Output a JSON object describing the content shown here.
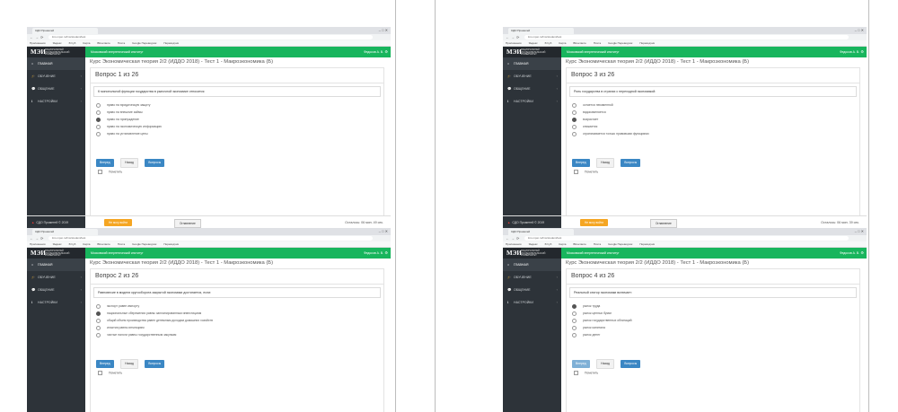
{
  "browser": {
    "tab_title": "СДО Прометей",
    "address": "lms.mpei.ru/lms/student/test",
    "bookmarks": [
      "Приложения",
      "Яндекс",
      "Ютуб",
      "Карта",
      "ВКонтакте",
      "Почта",
      "Google Переводчик",
      "Переводчик"
    ]
  },
  "sidebar": {
    "logo_mark": "МЭИ",
    "logo_text": "НАЦИОНАЛЬНЫЙ ИССЛЕДОВАТЕЛЬСКИЙ УНИВЕРСИТЕТ",
    "items": [
      {
        "label": "ГЛАВНАЯ",
        "icon": "home-icon"
      },
      {
        "label": "ОБУЧЕНИЕ",
        "icon": "graduation-cap-icon"
      },
      {
        "label": "ОБЩЕНИЕ",
        "icon": "chat-icon"
      },
      {
        "label": "НАСТРОЙКИ",
        "icon": "info-icon"
      }
    ],
    "footer": "СДО Прометей © 2019"
  },
  "header": {
    "institute": "Московский энергетический институт",
    "user": "Федосов А. В."
  },
  "course_title": "Курс Экономическая теория 2/2 (ИДДО 2018) - Тест 1 - Макроэкономика (Б)",
  "buttons": {
    "forward": "Вперед",
    "back": "Назад",
    "questions": "Вопросы",
    "mark": "Пометить",
    "help": "Не могу войти",
    "contents": "Оглавление"
  },
  "screens": [
    {
      "question_header": "Вопрос 1 из 26",
      "question": "К монопольной функции государства в рыночной экономике относится:",
      "options": [
        "право на юридическую защиту",
        "право на внешние займы",
        "право на принуждение",
        "право на экономическую информацию",
        "право на установление цены"
      ],
      "selected": 2,
      "remaining": "Осталось: 06 мин. 49 сек."
    },
    {
      "question_header": "Вопрос 3 из 26",
      "question": "Роль государства в странах с переходной экономикой:",
      "options": [
        "остается неизменной",
        "видоизменяется",
        "возрастает",
        "снижается",
        "ограничивается только правовыми функциями"
      ],
      "selected": 2,
      "remaining": "Осталось: 06 мин. 39 сек."
    },
    {
      "question_header": "Вопрос 2 из 26",
      "question": "Равновесие в модели кругооборота закрытой экономики достигается, если:",
      "options": [
        "экспорт равен импорту",
        "национальные сбережения равны запланированным инвестициям",
        "общий объем производства равен денежным доходам домашних хозяйств",
        "изъятия равны инъекциям",
        "чистые налоги равны государственным закупкам"
      ],
      "selected": 1,
      "remaining": ""
    },
    {
      "question_header": "Вопрос 4 из 26",
      "question": "Реальный сектор экономики включает:",
      "options": [
        "рынок труда",
        "рынок ценных бумаг",
        "рынок государственных облигаций",
        "рынок капитала",
        "рынок денег"
      ],
      "selected": 0,
      "remaining": ""
    }
  ]
}
